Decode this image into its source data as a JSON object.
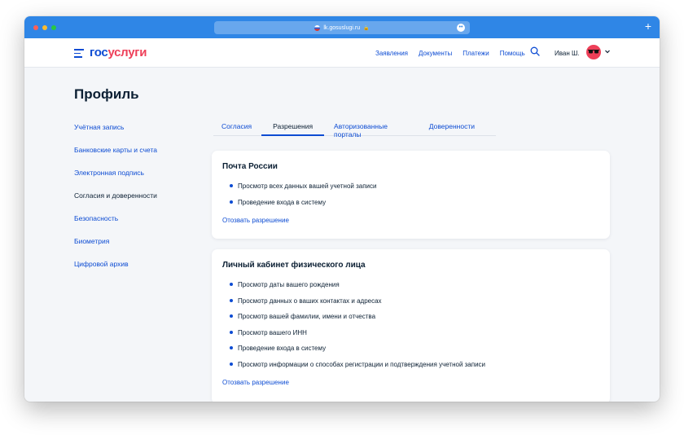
{
  "browser": {
    "url": "lk.gosuslugi.ru"
  },
  "header": {
    "logo_part1": "гос",
    "logo_part2": "услуги",
    "nav": [
      "Заявления",
      "Документы",
      "Платежи",
      "Помощь"
    ],
    "user_name": "Иван Ш."
  },
  "page": {
    "title": "Профиль"
  },
  "sidebar": {
    "items": [
      {
        "label": "Учётная запись"
      },
      {
        "label": "Банковские карты и счета"
      },
      {
        "label": "Электронная подпись"
      },
      {
        "label": "Согласия и доверенности"
      },
      {
        "label": "Безопасность"
      },
      {
        "label": "Биометрия"
      },
      {
        "label": "Цифровой архив"
      }
    ],
    "active_index": 3
  },
  "tabs": [
    {
      "label": "Согласия"
    },
    {
      "label": "Разрешения"
    },
    {
      "label": "Авторизованные порталы"
    },
    {
      "label": "Доверенности"
    }
  ],
  "active_tab": 1,
  "cards": [
    {
      "title": "Почта России",
      "permissions": [
        "Просмотр всех данных вашей учетной записи",
        "Проведение входа в систему"
      ],
      "revoke_label": "Отозвать разрешение"
    },
    {
      "title": "Личный кабинет физического лица",
      "permissions": [
        "Просмотр даты вашего рождения",
        "Просмотр данных о ваших контактах и адресах",
        "Просмотр вашей фамилии, имени и отчества",
        "Просмотр вашего ИНН",
        "Проведение входа в систему",
        "Просмотр информации о способах регистрации и подтверждения учетной записи"
      ],
      "revoke_label": "Отозвать разрешение"
    }
  ],
  "colors": {
    "accent": "#0d4cd3",
    "brand_red": "#ee3f58",
    "titlebar": "#2f86e6"
  }
}
